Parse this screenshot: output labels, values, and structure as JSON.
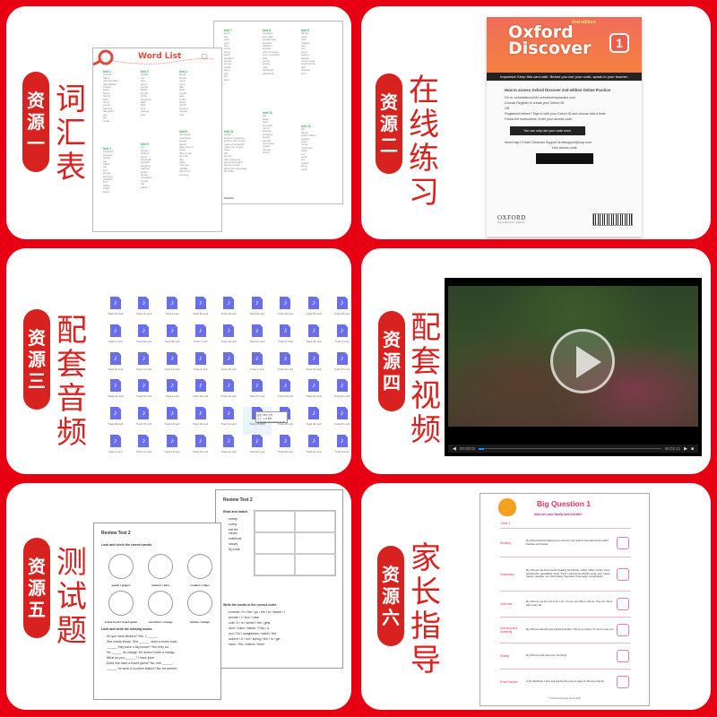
{
  "panels": [
    {
      "tag": [
        "资",
        "源",
        "一"
      ],
      "title": [
        "词",
        "汇",
        "表"
      ]
    },
    {
      "tag": [
        "资",
        "源",
        "二"
      ],
      "title": [
        "在",
        "线",
        "练",
        "习"
      ]
    },
    {
      "tag": [
        "资",
        "源",
        "三"
      ],
      "title": [
        "配",
        "套",
        "音",
        "频"
      ]
    },
    {
      "tag": [
        "资",
        "源",
        "四"
      ],
      "title": [
        "配",
        "套",
        "视",
        "频"
      ]
    },
    {
      "tag": [
        "资",
        "源",
        "五"
      ],
      "title": [
        "测",
        "试",
        "题"
      ]
    },
    {
      "tag": [
        "资",
        "源",
        "六"
      ],
      "title": [
        "家",
        "长",
        "指",
        "导"
      ]
    }
  ],
  "word_list": {
    "title": "Word List",
    "units_front": [
      "Unit 1",
      "Unit 2",
      "Unit 3",
      "Unit 4",
      "Unit 5",
      "Unit 6"
    ],
    "units_back": [
      "Unit 7",
      "Unit 8",
      "Unit 9",
      "Unit 10",
      "Unit 11",
      "Unit 12"
    ],
    "footer": "Wordlist"
  },
  "access_card": {
    "edition": "2nd edition",
    "brand_line1": "Oxford",
    "brand_line2": "Discover",
    "level": "1",
    "important": "Important: Keep this card safe. Before you use your code, speak to your teacher.",
    "how_to": "How to access Oxford Discover 2nd edition Online Practice",
    "step1": "Go to: oxforddiscover2e.oxfordonlinepractice.com",
    "step2": "Choose Register to create your Oxford ID.",
    "or": "OR",
    "step2b": "Registered before? Sign in with your Oxford ID and choose Add a level.",
    "step3": "Follow the instructions. Enter your access code.",
    "once": "You can only use your code once.",
    "help": "Need help? Email Customer Support at eltsupport@oup.com",
    "code_label": "Your access code",
    "publisher": "OXFORD",
    "publisher_sub": "UNIVERSITY PRESS"
  },
  "audio_files": [
    "Track 10.mp3",
    "Track 11.mp3",
    "Track 8.mp3",
    "Track 50.mp3",
    "Track 46.mp3",
    "Track 48.mp3",
    "Track 38.mp3",
    "Track 52.mp3",
    "Track 28.mp3",
    "Track 3.mp3",
    "Track 39.mp3",
    "Track 35.mp3",
    "Track 7.mp3",
    "Track 16.mp3",
    "Track 12.mp3",
    "Track 47.mp3",
    "Track 43.mp3",
    "Track 5.mp3",
    "Track 30.mp3",
    "Track 14.mp3",
    "Track 13.mp3",
    "Track 6.mp3",
    "Track 45.mp3",
    "Track 4.mp3",
    "Track 49.mp3",
    "Track 26.mp3",
    "Track 17.mp3",
    "Track 24.mp3",
    "Track 40.mp3",
    "Track 2.mp3",
    "Track 29.mp3",
    "Track 34.mp3",
    "Track 37.mp3",
    "Track 33.mp3",
    "Track 51.mp3",
    "Track 22.mp3",
    "Track 36.mp3",
    "Track 25.mp3",
    "Track 15.mp3",
    "Track 19.mp3",
    "Track 31.mp3",
    "Track 21.mp3",
    "Track 18.mp3",
    "Track 44.mp3",
    "Track 42.mp3",
    "Track 1.mp3",
    "Track 13.mp3",
    "Track 19.mp3",
    "Track 23.mp3",
    "Track 41.mp3",
    "Track 20.mp3",
    "Track 53.mp3",
    "Track 20.mp3",
    "Track 9.mp3"
  ],
  "audio_tooltip": [
    "类型: MP3 文件",
    "大小: 1.13 MB",
    "修改日期: 2017/12/22 20:45"
  ],
  "video": {
    "current_time": "00:00:02",
    "duration": "00:01:11",
    "progress_fraction": 0.03
  },
  "tests": {
    "left_title": "Review Test 2",
    "left_name": "Name:",
    "q1": "Look and circle the correct words.",
    "q1_options": [
      "peach / grapes",
      "stickers / pins",
      "cookies / chips",
      "comic book / board game",
      "cucumber / orange",
      "tomato / mango"
    ],
    "q2": "Look and write the missing words.",
    "q2_lines": [
      "Do you have stickers? Yes, I ______.",
      "She needs shoes. She ______ need a comic book.",
      "______ they have a big house? Yes, they do.",
      "He ______ an orange. He doesn't have a mango.",
      "What do you ______? I have juice.",
      "Does she have a board game? No, she ______.",
      "______ he work in a police station? No, he doesn't."
    ],
    "right_title": "Review Test 2",
    "r1": "Read and match.",
    "r1_items": [
      "snowy",
      "sunny",
      "eat ice cream",
      "notebook",
      "cloudy",
      "fly a kite"
    ],
    "r2": "Write the words in the correct order.",
    "r2_lines": [
      "summer / In / the / go / the / to / beach / I",
      "pencils / I / four / have",
      "cold / It / is / winter / the / gets",
      "don't / have / rabbit / They / a",
      "you / Do / sunglasses / watch / the",
      "doesn't / It / hot / spring / the / in / get",
      "have / You / kittens / three"
    ]
  },
  "parent_guide": {
    "title": "Big Question 1",
    "subtitle": "Who are your family and friends?",
    "unit": "Unit 1",
    "rows": [
      {
        "label": "Reading",
        "text": "My child practised predicting from pictures, and read an informational text called Families and Friends."
      },
      {
        "label": "Vocabulary",
        "text": "My child can use these words: Reading Text Words: mother, father, brother, sister, grandmother, grandfather, family, friend. Listening Text Words: uncle, aunt, cousin, parents, daughter, son. Word Study: Opposites: A big family. A small family."
      },
      {
        "label": "Grammar",
        "text": "My child can use the verb to be. I am. You are. He / She is. We are. They are. We're eight years old."
      },
      {
        "label": "Listening and Speaking",
        "text": "My child can describe and introduce families. This is my brother. It's nice to meet you."
      },
      {
        "label": "Writing",
        "text": "My child can write about his / her family."
      },
      {
        "label": "Extra Practice",
        "text": "In the Workbook. Listen and practise the song on page 13: We Are a Family."
      }
    ],
    "footer": "© Oxford University Press 2018"
  }
}
